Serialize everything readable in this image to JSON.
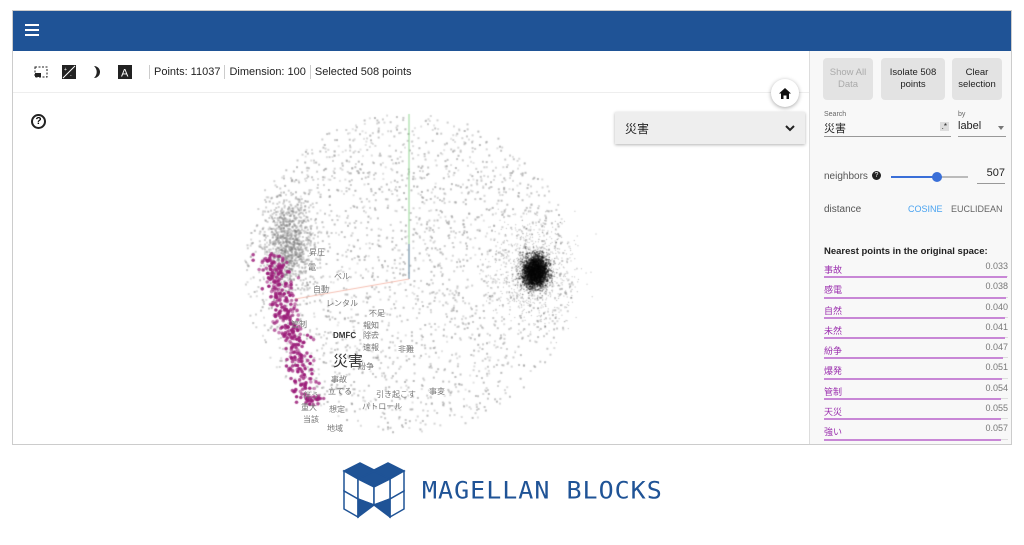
{
  "header": {
    "menu_icon": "hamburger-menu-icon",
    "color": "#1f5396"
  },
  "toolbar": {
    "icons": [
      "selection-rectangle-icon",
      "night-mode-contrast-icon",
      "moon-icon",
      "label-a-icon"
    ],
    "points": "Points: 11037",
    "dimension": "Dimension: 100",
    "selected": "Selected 508 points"
  },
  "plot": {
    "help": "?",
    "dropdown_value": "災害",
    "labels": [
      "昇圧",
      "電",
      "ベル",
      "自動",
      "レンタル",
      "不足",
      "報知",
      "除去",
      "管制",
      "DMFC",
      "速報",
      "非難",
      "災害",
      "紛争",
      "事故",
      "立てる",
      "引き起こす",
      "事変",
      "伴う",
      "重大",
      "想定",
      "パトロール",
      "当該",
      "地域"
    ],
    "selected_color": "#9c1f7a"
  },
  "panel": {
    "show_all": "Show All Data",
    "isolate": "Isolate 508 points",
    "clear": "Clear selection",
    "search_label": "Search",
    "search_value": "災害",
    "regex_icon": ".*",
    "by_label": "by",
    "by_value": "label",
    "neighbors_label": "neighbors",
    "neighbors_value": "507",
    "neighbors_fraction": 0.6,
    "distance_label": "distance",
    "cosine": "COSINE",
    "euclidean": "EUCLIDEAN",
    "nearest_title": "Nearest points in the original space:",
    "nearest": [
      {
        "label": "事故",
        "value": "0.033"
      },
      {
        "label": "感電",
        "value": "0.038"
      },
      {
        "label": "自然",
        "value": "0.040"
      },
      {
        "label": "未然",
        "value": "0.041"
      },
      {
        "label": "紛争",
        "value": "0.047"
      },
      {
        "label": "爆発",
        "value": "0.051"
      },
      {
        "label": "管制",
        "value": "0.054"
      },
      {
        "label": "天災",
        "value": "0.055"
      },
      {
        "label": "強い",
        "value": "0.057"
      },
      {
        "label": "",
        "value": "0.057"
      }
    ]
  },
  "logo": {
    "text": "MAGELLAN BLOCKS"
  }
}
